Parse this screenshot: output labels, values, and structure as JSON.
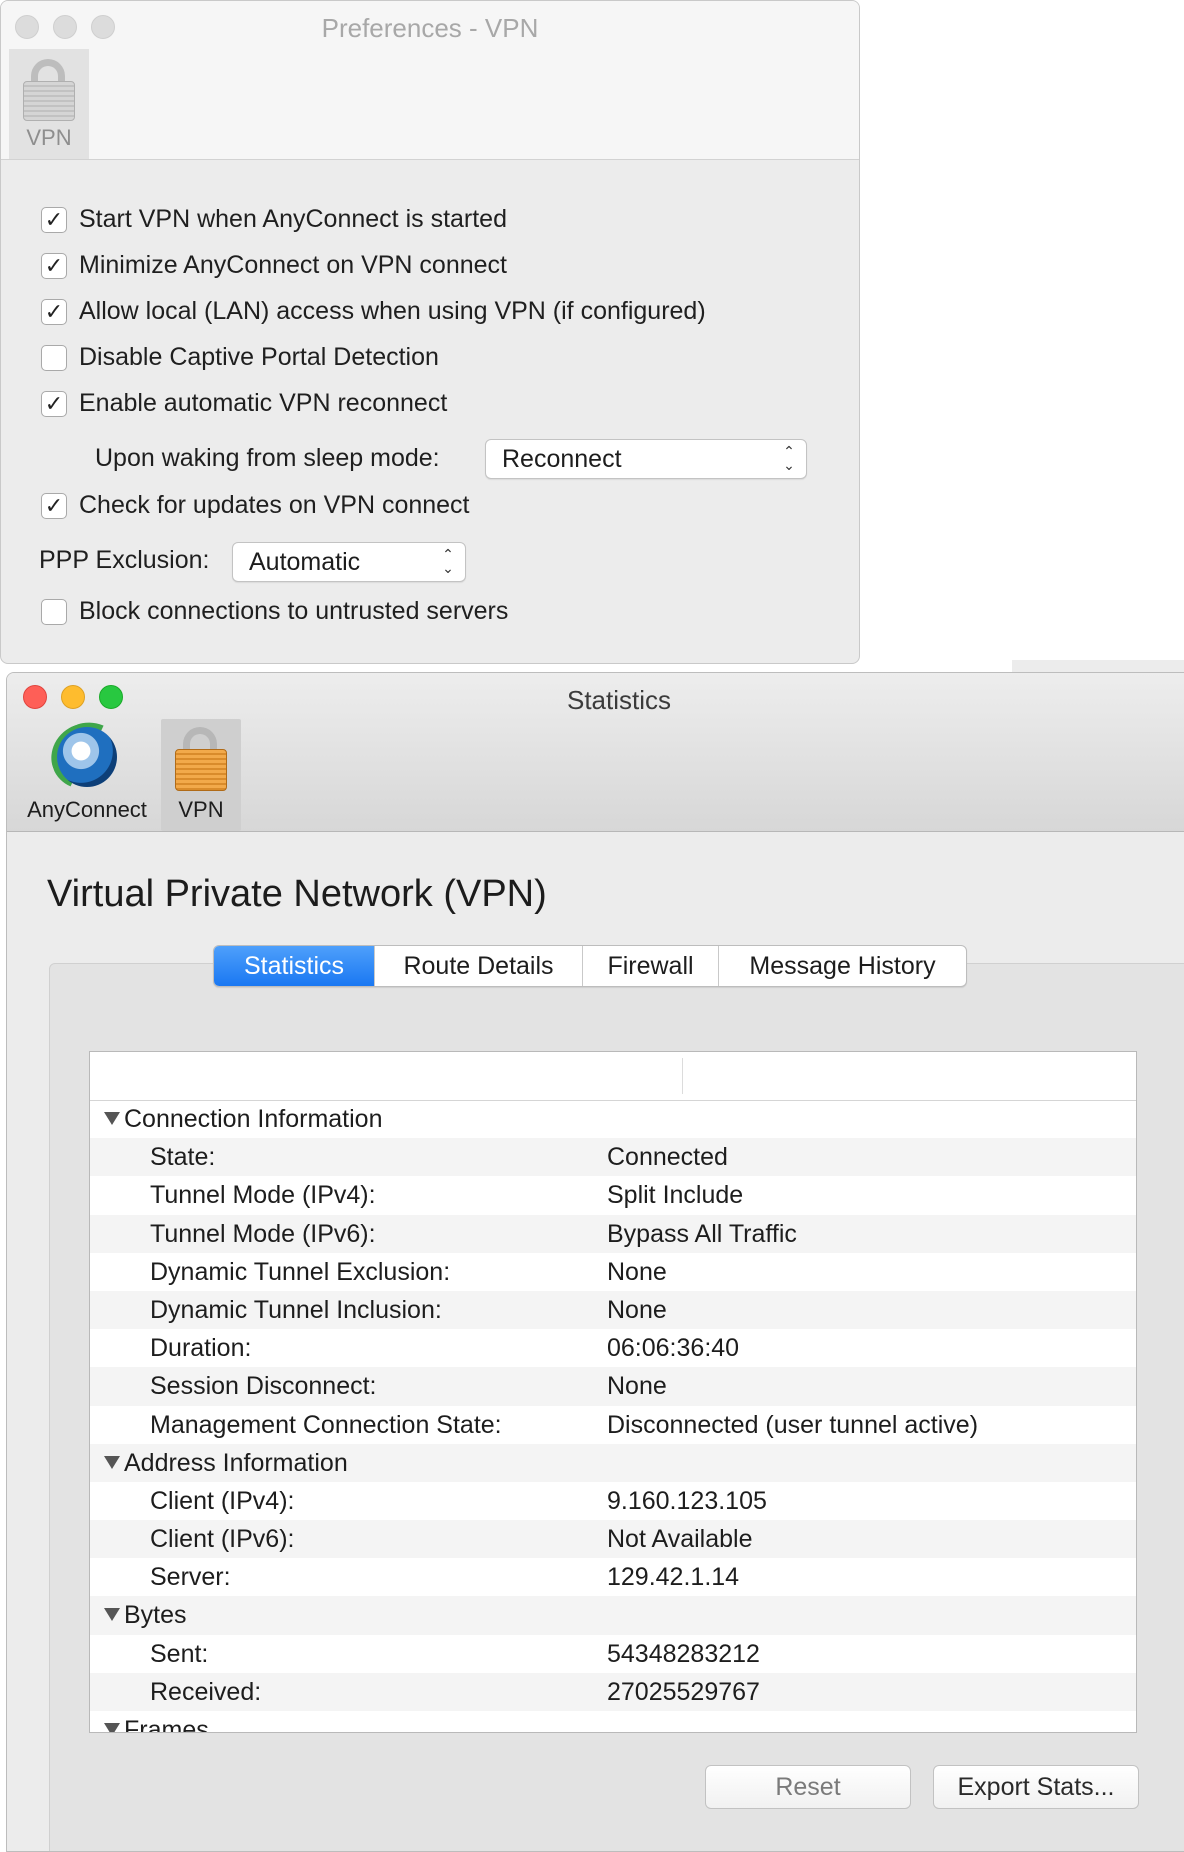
{
  "prefs_window": {
    "title": "Preferences - VPN",
    "toolbar": {
      "vpn_label": "VPN"
    },
    "options": [
      {
        "label": "Start VPN when AnyConnect is started",
        "checked": true
      },
      {
        "label": "Minimize AnyConnect on VPN connect",
        "checked": true
      },
      {
        "label": "Allow local (LAN) access when using VPN (if configured)",
        "checked": true
      },
      {
        "label": "Disable Captive Portal Detection",
        "checked": false
      },
      {
        "label": "Enable automatic VPN reconnect",
        "checked": true
      }
    ],
    "sleep_mode": {
      "label": "Upon waking from sleep mode:",
      "value": "Reconnect"
    },
    "check_updates": {
      "label": "Check for updates on VPN connect",
      "checked": true
    },
    "ppp_exclusion": {
      "label": "PPP Exclusion:",
      "value": "Automatic"
    },
    "block_untrusted": {
      "label": "Block connections to untrusted servers",
      "checked": false
    }
  },
  "stats_window": {
    "title": "Statistics",
    "toolbar": {
      "anyconnect_label": "AnyConnect",
      "vpn_label": "VPN"
    },
    "heading": "Virtual Private Network (VPN)",
    "tabs": [
      "Statistics",
      "Route Details",
      "Firewall",
      "Message History"
    ],
    "rows": [
      {
        "type": "group",
        "label": "Connection Information"
      },
      {
        "type": "item",
        "label": "State:",
        "value": "Connected"
      },
      {
        "type": "item",
        "label": "Tunnel Mode (IPv4):",
        "value": "Split Include"
      },
      {
        "type": "item",
        "label": "Tunnel Mode (IPv6):",
        "value": "Bypass All Traffic"
      },
      {
        "type": "item",
        "label": "Dynamic Tunnel Exclusion:",
        "value": "None"
      },
      {
        "type": "item",
        "label": "Dynamic Tunnel Inclusion:",
        "value": "None"
      },
      {
        "type": "item",
        "label": "Duration:",
        "value": "06:06:36:40"
      },
      {
        "type": "item",
        "label": "Session Disconnect:",
        "value": "None"
      },
      {
        "type": "item",
        "label": "Management Connection State:",
        "value": "Disconnected (user tunnel active)"
      },
      {
        "type": "group",
        "label": "Address Information"
      },
      {
        "type": "item",
        "label": "Client (IPv4):",
        "value": "9.160.123.105"
      },
      {
        "type": "item",
        "label": "Client (IPv6):",
        "value": "Not Available"
      },
      {
        "type": "item",
        "label": "Server:",
        "value": "129.42.1.14"
      },
      {
        "type": "group",
        "label": "Bytes"
      },
      {
        "type": "item",
        "label": "Sent:",
        "value": "54348283212"
      },
      {
        "type": "item",
        "label": "Received:",
        "value": "27025529767"
      },
      {
        "type": "group",
        "label": "Frames"
      }
    ],
    "buttons": {
      "reset": "Reset",
      "export": "Export Stats..."
    }
  }
}
